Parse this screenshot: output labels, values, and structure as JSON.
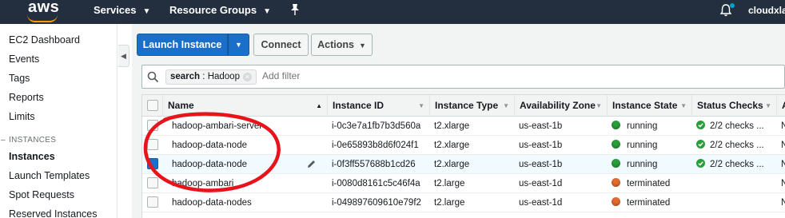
{
  "topnav": {
    "logo": "aws",
    "services": "Services",
    "resource_groups": "Resource Groups",
    "user": "cloudxlab"
  },
  "sidebar": {
    "items": [
      "EC2 Dashboard",
      "Events",
      "Tags",
      "Reports",
      "Limits"
    ],
    "section": "INSTANCES",
    "section_items": [
      "Instances",
      "Launch Templates",
      "Spot Requests",
      "Reserved Instances"
    ]
  },
  "toolbar": {
    "launch_label": "Launch Instance",
    "connect_label": "Connect",
    "actions_label": "Actions"
  },
  "filter": {
    "token_key": "search",
    "token_value": "Hadoop",
    "placeholder": "Add filter"
  },
  "table": {
    "columns": [
      "Name",
      "Instance ID",
      "Instance Type",
      "Availability Zone",
      "Instance State",
      "Status Checks",
      "A"
    ],
    "rows": [
      {
        "name": "hadoop-ambari-server",
        "id": "i-0c3e7a1fb7b3d560a",
        "type": "t2.xlarge",
        "zone": "us-east-1b",
        "state": "running",
        "checks": "2/2 checks ...",
        "extra": "N",
        "selected": false
      },
      {
        "name": "hadoop-data-node",
        "id": "i-0e65893b8d6f024f1",
        "type": "t2.xlarge",
        "zone": "us-east-1b",
        "state": "running",
        "checks": "2/2 checks ...",
        "extra": "N",
        "selected": false
      },
      {
        "name": "hadoop-data-node",
        "id": "i-0f3ff557688b1cd26",
        "type": "t2.xlarge",
        "zone": "us-east-1b",
        "state": "running",
        "checks": "2/2 checks ...",
        "extra": "N",
        "selected": true
      },
      {
        "name": "hadoop-ambari",
        "id": "i-0080d8161c5c46f4a",
        "type": "t2.large",
        "zone": "us-east-1d",
        "state": "terminated",
        "checks": "",
        "extra": "N",
        "selected": false
      },
      {
        "name": "hadoop-data-nodes",
        "id": "i-049897609610e79f2",
        "type": "t2.large",
        "zone": "us-east-1d",
        "state": "terminated",
        "checks": "",
        "extra": "N",
        "selected": false
      }
    ]
  },
  "colors": {
    "nav_bg": "#232f3e",
    "brand_orange": "#ff9900",
    "primary_blue": "#1a6fc9",
    "running_green": "#2b9e3c",
    "terminated_orange": "#e66a2c",
    "annotation_red": "#e8141b"
  },
  "icons": [
    "pin-icon",
    "bell-icon",
    "search-icon",
    "close-icon",
    "chevron-down-icon",
    "check-icon",
    "edit-icon"
  ]
}
